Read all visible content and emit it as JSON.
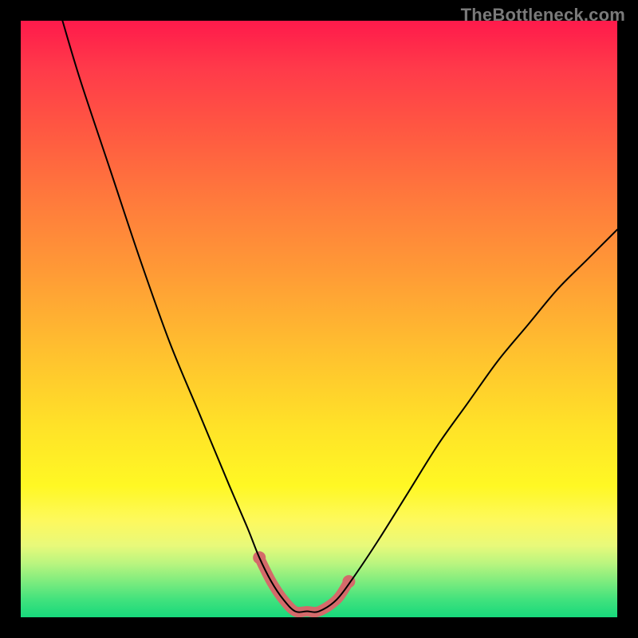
{
  "watermark": {
    "text": "TheBottleneck.com"
  },
  "chart_data": {
    "type": "line",
    "title": "",
    "xlabel": "",
    "ylabel": "",
    "xlim": [
      0,
      100
    ],
    "ylim": [
      0,
      100
    ],
    "grid": false,
    "series": [
      {
        "name": "bottleneck-curve",
        "x": [
          7,
          10,
          15,
          20,
          25,
          30,
          35,
          38,
          40,
          42,
          44,
          46,
          48,
          50,
          53,
          56,
          60,
          65,
          70,
          75,
          80,
          85,
          90,
          95,
          100
        ],
        "values": [
          100,
          90,
          75,
          60,
          46,
          34,
          22,
          15,
          10,
          6,
          3,
          1,
          1,
          1,
          3,
          7,
          13,
          21,
          29,
          36,
          43,
          49,
          55,
          60,
          65
        ]
      },
      {
        "name": "safe-zone-highlight",
        "x": [
          40,
          42,
          44,
          46,
          48,
          50,
          53,
          55
        ],
        "values": [
          10,
          6,
          3,
          1,
          1,
          1,
          3,
          6
        ]
      }
    ],
    "gradient_stops": [
      {
        "pos": 0,
        "color": "#ff1a4b"
      },
      {
        "pos": 50,
        "color": "#ffbf2f"
      },
      {
        "pos": 80,
        "color": "#fff824"
      },
      {
        "pos": 100,
        "color": "#17d97c"
      }
    ]
  }
}
